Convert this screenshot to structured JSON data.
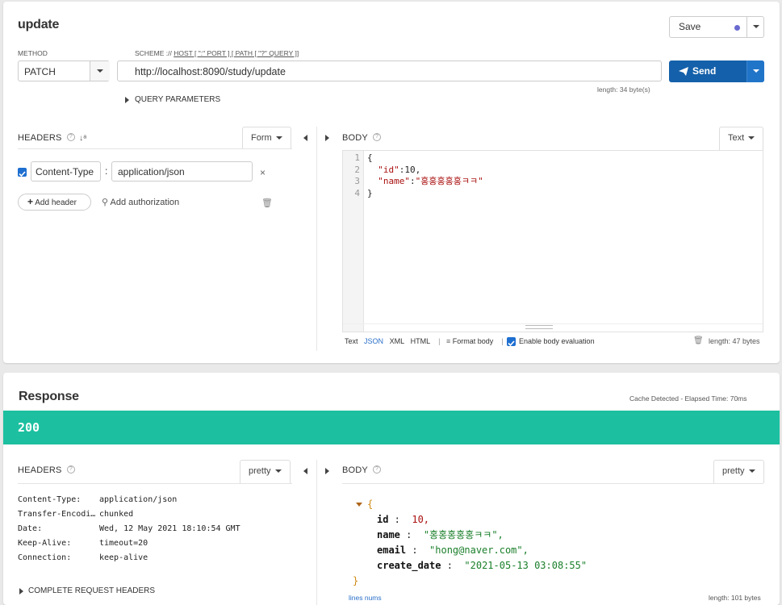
{
  "request": {
    "title": "update",
    "method_label": "METHOD",
    "method_value": "PATCH",
    "scheme_prefix": "SCHEME :// ",
    "scheme_rest": "HOST [ \":\" PORT ] [ PATH [ \"?\" QUERY ]]",
    "url": "http://localhost:8090/study/update",
    "url_length": "length: 34 byte(s)",
    "save_label": "Save",
    "send_label": "Send",
    "query_params_label": "QUERY PARAMETERS",
    "headers_label": "HEADERS",
    "headers_mode": "Form",
    "header_name": "Content-Type",
    "header_value": "application/json",
    "add_header_label": "Add header",
    "add_auth_label": "Add authorization",
    "body_label": "BODY",
    "body_mode": "Text",
    "body_lines": [
      "1",
      "2",
      "3",
      "4"
    ],
    "body_code": {
      "l1": "{",
      "l2_key": "\"id\"",
      "l2_val": "10,",
      "l3_key": "\"name\"",
      "l3_val": "\"홍홍홍홍홍ㅋㅋ\"",
      "l4": "}"
    },
    "body_footer": {
      "text": "Text",
      "json": "JSON",
      "xml": "XML",
      "html": "HTML",
      "format": "Format body",
      "enable_eval": "Enable body evaluation",
      "length": "length: 47 bytes"
    }
  },
  "response": {
    "title": "Response",
    "cache_info": "Cache Detected - Elapsed Time: 70ms",
    "status_code": "200",
    "headers_label": "HEADERS",
    "headers_mode": "pretty",
    "headers": [
      {
        "key": "Content-Type:",
        "value": "application/json"
      },
      {
        "key": "Transfer-Encodi…",
        "value": "chunked"
      },
      {
        "key": "Date:",
        "value": "Wed, 12 May 2021 18:10:54 GMT"
      },
      {
        "key": "Keep-Alive:",
        "value": "timeout=20"
      },
      {
        "key": "Connection:",
        "value": "keep-alive"
      }
    ],
    "complete_headers_label": "COMPLETE REQUEST HEADERS",
    "body_label": "BODY",
    "body_mode": "pretty",
    "json": {
      "id_key": "id",
      "id_val": "10,",
      "name_key": "name",
      "name_val": "\"홍홍홍홍홍ㅋㅋ\",",
      "email_key": "email",
      "email_val": "\"hong@naver.com\",",
      "date_key": "create_date",
      "date_val": "\"2021-05-13 03:08:55\""
    },
    "lines_nums_label": "lines nums",
    "length": "length: 101 bytes"
  },
  "colors": {
    "send_button": "#1460aa",
    "status_bar": "#1cc0a0",
    "save_dot": "#6a6ad0"
  }
}
